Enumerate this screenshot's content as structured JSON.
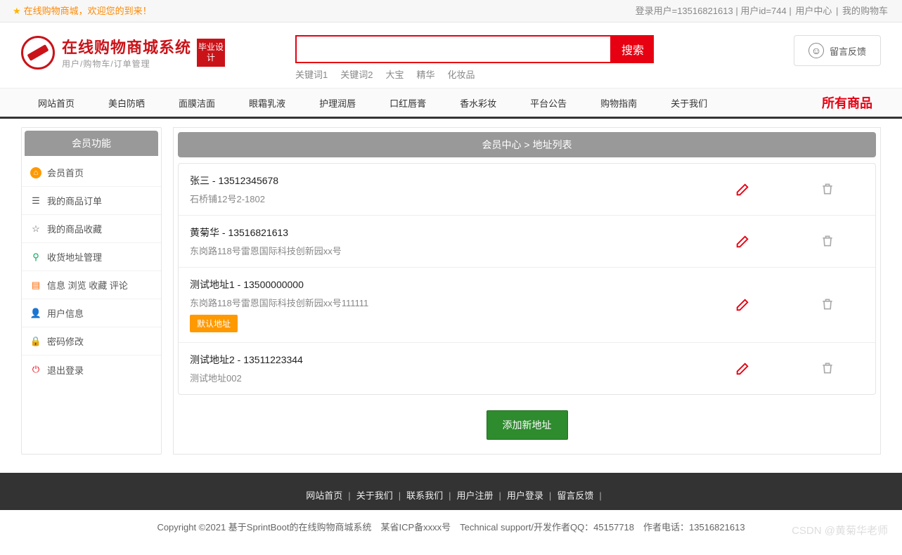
{
  "topbar": {
    "welcome": "在线购物商城，欢迎您的到来！",
    "login_user_label": "登录用户=13516821613",
    "user_id_label": "用户id=744",
    "user_center": "用户中心",
    "my_cart": "我的购物车"
  },
  "logo": {
    "title": "在线购物商城系统",
    "subtitle": "用户/购物车/订单管理",
    "badge": "毕业设计"
  },
  "search": {
    "button": "搜索",
    "placeholder": "",
    "keywords": [
      "关键词1",
      "关键词2",
      "大宝",
      "精华",
      "化妆品"
    ]
  },
  "feedback": {
    "label": "留言反馈"
  },
  "nav": {
    "items": [
      "网站首页",
      "美白防晒",
      "面膜洁面",
      "眼霜乳液",
      "护理润唇",
      "口红唇膏",
      "香水彩妆",
      "平台公告",
      "购物指南",
      "关于我们"
    ],
    "all": "所有商品"
  },
  "sidebar": {
    "title": "会员功能",
    "items": [
      {
        "label": "会员首页",
        "icon": "home",
        "cls": "ic-orange"
      },
      {
        "label": "我的商品订单",
        "icon": "order",
        "cls": ""
      },
      {
        "label": "我的商品收藏",
        "icon": "star",
        "cls": ""
      },
      {
        "label": "收货地址管理",
        "icon": "pin",
        "cls": "ic-green"
      },
      {
        "label": "信息 浏览 收藏 评论",
        "icon": "list",
        "cls": "ic-orange2"
      },
      {
        "label": "用户信息",
        "icon": "user",
        "cls": "ic-blue"
      },
      {
        "label": "密码修改",
        "icon": "lock",
        "cls": "ic-orange2"
      },
      {
        "label": "退出登录",
        "icon": "power",
        "cls": "ic-red"
      }
    ]
  },
  "content": {
    "breadcrumb": "会员中心 > 地址列表",
    "addresses": [
      {
        "title": "张三 - 13512345678",
        "detail": "石桥铺12号2-1802",
        "default": false
      },
      {
        "title": "黄菊华 - 13516821613",
        "detail": "东岗路118号雷恩国际科技创新园xx号",
        "default": false
      },
      {
        "title": "测试地址1 - 13500000000",
        "detail": "东岗路118号雷恩国际科技创新园xx号111111",
        "default": true
      },
      {
        "title": "测试地址2 - 13511223344",
        "detail": "测试地址002",
        "default": false
      }
    ],
    "default_tag": "默认地址",
    "add_button": "添加新地址"
  },
  "footer": {
    "links": [
      "网站首页",
      "关于我们",
      "联系我们",
      "用户注册",
      "用户登录",
      "留言反馈"
    ],
    "copyright": "Copyright ©2021 基于SprintBoot的在线购物商城系统　某省ICP备xxxx号　Technical support/开发作者QQ：45157718　作者电话：13516821613",
    "watermark": "CSDN @黄菊华老师"
  }
}
